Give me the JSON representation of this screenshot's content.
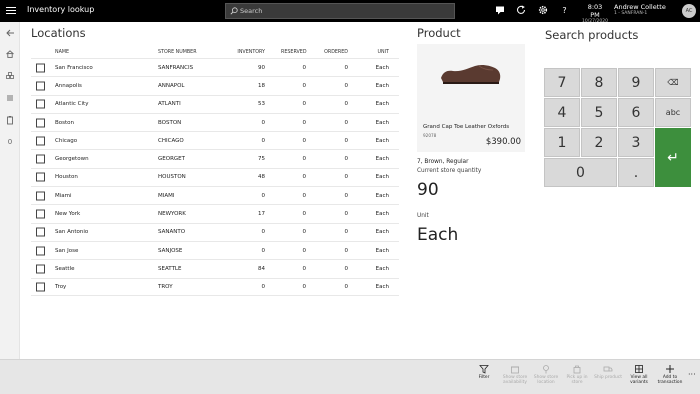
{
  "app": {
    "title": "Inventory lookup"
  },
  "search": {
    "placeholder": "Search"
  },
  "header": {
    "time": "8:03 PM",
    "date": "10/27/2020",
    "user_name": "Andrew Collette",
    "store": "1 - SANFRAN-1",
    "avatar_initials": "AC",
    "icons": [
      "chat-icon",
      "refresh-icon",
      "gear-icon",
      "help-icon"
    ],
    "help_glyph": "?"
  },
  "nav": {
    "icons": [
      "back-icon",
      "home-icon",
      "products-icon",
      "list-icon",
      "clipboard-icon"
    ],
    "count": "0"
  },
  "locations": {
    "title": "Locations",
    "columns": {
      "name": "NAME",
      "store": "STORE NUMBER",
      "inventory": "INVENTORY",
      "reserved": "RESERVED",
      "ordered": "ORDERED",
      "unit": "UNIT"
    },
    "rows": [
      {
        "name": "San Francisco",
        "store": "SANFRANCIS",
        "inventory": "90",
        "reserved": "0",
        "ordered": "0",
        "unit": "Each"
      },
      {
        "name": "Annapolis",
        "store": "ANNAPOL",
        "inventory": "18",
        "reserved": "0",
        "ordered": "0",
        "unit": "Each"
      },
      {
        "name": "Atlantic City",
        "store": "ATLANTI",
        "inventory": "53",
        "reserved": "0",
        "ordered": "0",
        "unit": "Each"
      },
      {
        "name": "Boston",
        "store": "BOSTON",
        "inventory": "0",
        "reserved": "0",
        "ordered": "0",
        "unit": "Each"
      },
      {
        "name": "Chicago",
        "store": "CHICAGO",
        "inventory": "0",
        "reserved": "0",
        "ordered": "0",
        "unit": "Each"
      },
      {
        "name": "Georgetown",
        "store": "GEORGET",
        "inventory": "75",
        "reserved": "0",
        "ordered": "0",
        "unit": "Each"
      },
      {
        "name": "Houston",
        "store": "HOUSTON",
        "inventory": "48",
        "reserved": "0",
        "ordered": "0",
        "unit": "Each"
      },
      {
        "name": "Miami",
        "store": "MIAMI",
        "inventory": "0",
        "reserved": "0",
        "ordered": "0",
        "unit": "Each"
      },
      {
        "name": "New York",
        "store": "NEWYORK",
        "inventory": "17",
        "reserved": "0",
        "ordered": "0",
        "unit": "Each"
      },
      {
        "name": "San Antonio",
        "store": "SANANTO",
        "inventory": "0",
        "reserved": "0",
        "ordered": "0",
        "unit": "Each"
      },
      {
        "name": "San Jose",
        "store": "SANJOSE",
        "inventory": "0",
        "reserved": "0",
        "ordered": "0",
        "unit": "Each"
      },
      {
        "name": "Seattle",
        "store": "SEATTLE",
        "inventory": "84",
        "reserved": "0",
        "ordered": "0",
        "unit": "Each"
      },
      {
        "name": "Troy",
        "store": "TROY",
        "inventory": "0",
        "reserved": "0",
        "ordered": "0",
        "unit": "Each"
      }
    ]
  },
  "product": {
    "title": "Product",
    "name": "Grand Cap Toe Leather Oxfords",
    "id": "92078",
    "price": "$390.00",
    "variant": "7, Brown, Regular",
    "quantity_label": "Current store quantity",
    "quantity": "90",
    "unit_label": "Unit",
    "unit": "Each"
  },
  "search_products": {
    "title": "Search products",
    "keys": [
      "7",
      "8",
      "9",
      "⌫",
      "4",
      "5",
      "6",
      "abc",
      "1",
      "2",
      "3",
      "↵",
      "0",
      "."
    ]
  },
  "actions": [
    {
      "label": "Filter",
      "icon": "filter-icon",
      "enabled": true
    },
    {
      "label": "Show store availability",
      "icon": "store-availability-icon",
      "enabled": false
    },
    {
      "label": "Show store location",
      "icon": "store-location-icon",
      "enabled": false
    },
    {
      "label": "Pick up in store",
      "icon": "pickup-icon",
      "enabled": false
    },
    {
      "label": "Ship product",
      "icon": "ship-icon",
      "enabled": false
    },
    {
      "label": "View all variants",
      "icon": "variants-icon",
      "enabled": true
    },
    {
      "label": "Add to transaction",
      "icon": "add-icon",
      "enabled": true
    }
  ],
  "colors": {
    "topbar": "#000000",
    "enter_key": "#3d8f3d",
    "key": "#d9d9d9",
    "bottombar": "#e6e6e6"
  }
}
